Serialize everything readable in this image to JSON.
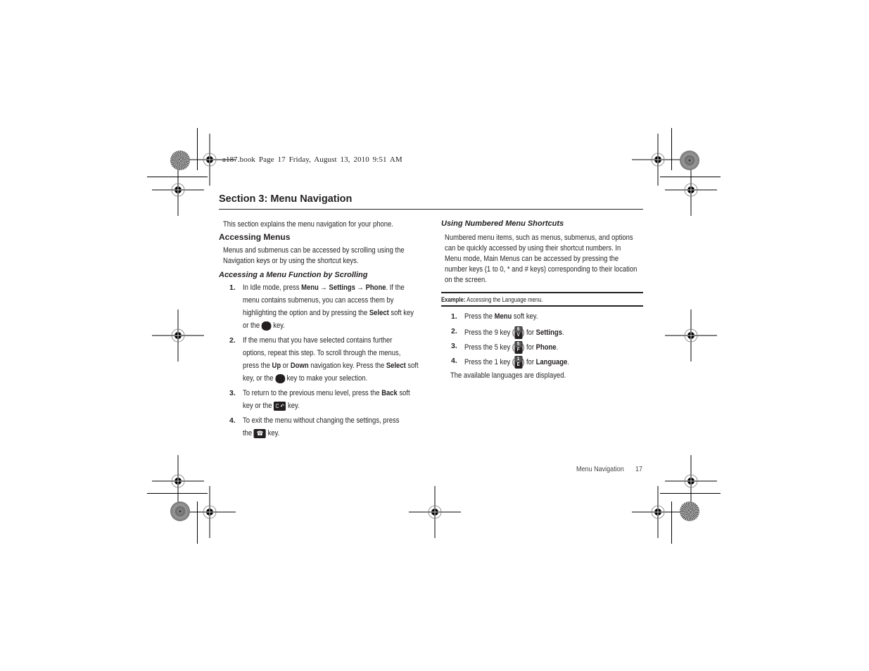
{
  "print_header": "a187.book  Page 17  Friday, August 13, 2010  9:51 AM",
  "section_title": "Section 3: Menu Navigation",
  "left_column": {
    "intro": "This section explains the menu navigation for your phone.",
    "heading": "Accessing Menus",
    "heading_body_1": "Menus and submenus can be accessed by scrolling using the",
    "heading_body_2": "Navigation keys or by using the shortcut keys.",
    "subheading": "Accessing a Menu Function by Scrolling",
    "steps": [
      {
        "num": "1.",
        "l1_a": "In Idle mode, press ",
        "l1_b1": "Menu",
        "l1_arrow1": " → ",
        "l1_b2": "Settings",
        "l1_arrow2": " → ",
        "l1_b3": "Phone",
        "l1_c": ". If the",
        "l2": "menu contains submenus, you can access them by",
        "l3_a": "highlighting the option and by pressing the ",
        "l3_b": "Select",
        "l3_c": " soft key",
        "l4_a": "or the ",
        "l4_icon": "navigation-center-key",
        "l4_c": " key."
      },
      {
        "num": "2.",
        "l1": "If the menu that you have selected contains further",
        "l2": "options, repeat this step. To scroll through the menus,",
        "l3_a": "press the ",
        "l3_b1": "Up",
        "l3_mid": " or ",
        "l3_b2": "Down",
        "l3_c": " navigation key. Press the ",
        "l3_b3": "Select",
        "l3_d": " soft",
        "l4_a": "key, or the ",
        "l4_icon": "navigation-center-key",
        "l4_c": " key to make your selection."
      },
      {
        "num": "3.",
        "l1_a": "To return to the previous menu level, press the ",
        "l1_b": "Back",
        "l1_c": " soft",
        "l2_a": "key or the ",
        "l2_icon": "back-clear-key",
        "l2_icon_text": "C ↶",
        "l2_c": " key."
      },
      {
        "num": "4.",
        "l1": "To exit the menu without changing the settings, press",
        "l2_a": "the ",
        "l2_icon": "end-key",
        "l2_icon_text": "☎",
        "l2_c": " key."
      }
    ]
  },
  "right_column": {
    "subheading": "Using Numbered Menu Shortcuts",
    "body": [
      "Numbered menu items, such as menus, submenus, and options",
      "can be quickly accessed by using their shortcut numbers. In",
      "Menu mode, Main Menus can be accessed by pressing the",
      "number keys (1 to 0, * and # keys) corresponding to their location",
      "on the screen."
    ],
    "example_label": "Example:",
    "example_text": " Accessing the Language menu.",
    "steps": [
      {
        "num": "1.",
        "a": "Press the ",
        "b": "Menu",
        "c": " soft key."
      },
      {
        "num": "2.",
        "a": "Press the 9 key (",
        "key_top": "9",
        "key_bottom": "V",
        "c": ") for ",
        "b": "Settings",
        "d": "."
      },
      {
        "num": "3.",
        "a": "Press the 5 key (",
        "key_top": "5",
        "key_bottom": "F",
        "c": ") for ",
        "b": "Phone",
        "d": "."
      },
      {
        "num": "4.",
        "a": "Press the 1 key (",
        "key_top": "1",
        "key_bottom": "E",
        "c": ") for ",
        "b": "Language",
        "d": "."
      }
    ],
    "result": "The available languages are displayed."
  },
  "footer": {
    "section": "Menu Navigation",
    "page": "17"
  }
}
